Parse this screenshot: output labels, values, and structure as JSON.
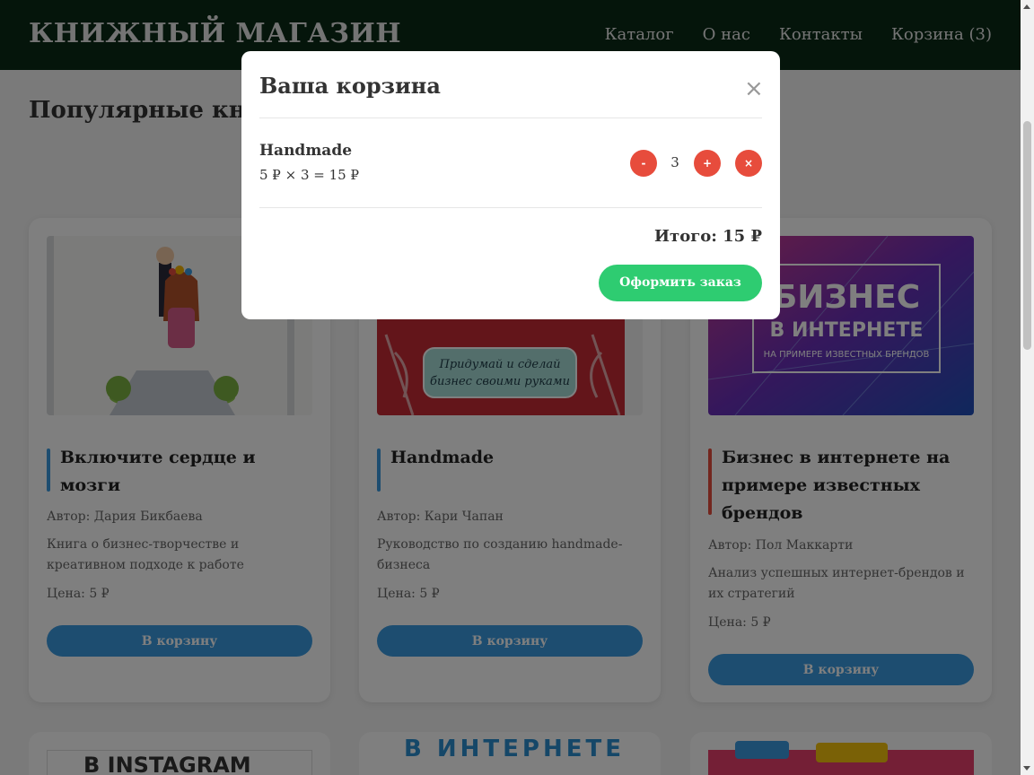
{
  "header": {
    "logo": "КНИЖНЫЙ МАГАЗИН",
    "nav": [
      "Каталог",
      "О нас",
      "Контакты",
      "Корзина (3)"
    ]
  },
  "section_title": "Популярные книги",
  "books": [
    {
      "title": "Включите сердце и мозги",
      "author": "Автор: Дария Бикбаева",
      "description": "Книга о бизнес-творчестве и креативном подходе к работе",
      "price": "Цена: 5 ₽",
      "button": "В корзину",
      "accent": "#3b9be0"
    },
    {
      "title": "Handmade",
      "author": "Автор: Кари Чапан",
      "description": "Руководство по созданию handmade-бизнеса",
      "price": "Цена: 5 ₽",
      "button": "В корзину",
      "accent": "#3b9be0",
      "cover_text": "Придумай и сделай бизнес своими руками"
    },
    {
      "title": "Бизнес в интернете на примере известных брендов",
      "author": "Автор: Пол Маккарти",
      "description": "Анализ успешных интернет-брендов и их стратегий",
      "price": "Цена: 5 ₽",
      "button": "В корзину",
      "accent": "#e74c3c",
      "cover_text_1": "БИЗНЕС",
      "cover_text_2": "В ИНТЕРНЕТЕ",
      "cover_text_3": "НА ПРИМЕРЕ ИЗВЕСТНЫХ БРЕНДОВ"
    }
  ],
  "second_row": {
    "card1_cover_text": "В INSTAGRAM",
    "card2_cover_text": "В ИНТЕРНЕТЕ"
  },
  "cart_modal": {
    "title": "Ваша корзина",
    "close_icon": "×",
    "item": {
      "name": "Handmade",
      "calc": "5 ₽ × 3 = 15 ₽",
      "quantity": "3",
      "minus": "-",
      "plus": "+",
      "remove": "×"
    },
    "total": "Итого: 15 ₽",
    "checkout": "Оформить заказ"
  },
  "colors": {
    "header_bg": "#0b2a17",
    "primary_button": "#3b9be0",
    "danger": "#e74c3c",
    "success": "#2ecc71"
  }
}
